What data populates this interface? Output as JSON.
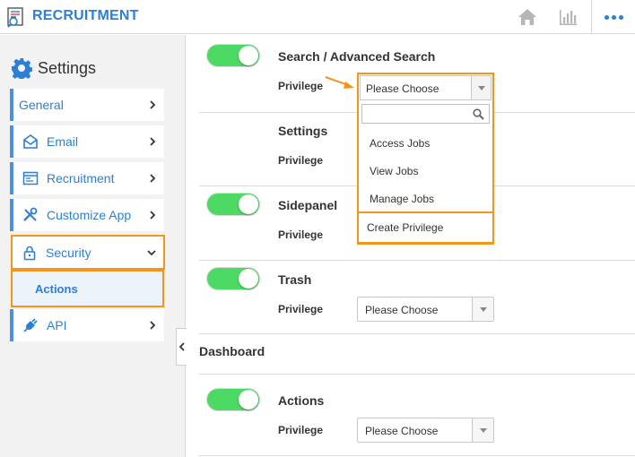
{
  "header": {
    "app_title": "RECRUITMENT",
    "icons": [
      "recruitment-logo-icon",
      "home-icon",
      "bar-chart-icon",
      "more-icon"
    ],
    "accent_color": "#2b7fd6"
  },
  "sidebar": {
    "heading": "Settings",
    "items": [
      {
        "label": "General",
        "icon": ""
      },
      {
        "label": "Email",
        "icon": "envelope-icon"
      },
      {
        "label": "Recruitment",
        "icon": "window-icon"
      },
      {
        "label": "Customize App",
        "icon": "tools-icon"
      },
      {
        "label": "Security",
        "icon": "lock-icon",
        "expanded": true
      },
      {
        "label": "API",
        "icon": "plug-icon"
      }
    ],
    "sub_item": "Actions",
    "highlight_color": "#f3951c"
  },
  "main": {
    "sections": [
      {
        "title": "Search / Advanced Search",
        "privilege_label": "Privilege",
        "toggle_on": true,
        "select_value": "Please Choose"
      },
      {
        "title": "Settings",
        "privilege_label": "Privilege",
        "toggle_on": false
      },
      {
        "title": "Sidepanel",
        "privilege_label": "Privilege",
        "toggle_on": true
      },
      {
        "title": "Trash",
        "privilege_label": "Privilege",
        "toggle_on": true,
        "select_value": "Please Choose"
      }
    ],
    "dashboard_heading": "Dashboard",
    "dashboard_sections": [
      {
        "title": "Actions",
        "privilege_label": "Privilege",
        "toggle_on": true,
        "select_value": "Please Choose"
      }
    ],
    "toggle_color": "#4cd964"
  },
  "dropdown": {
    "selected": "Please Choose",
    "search_placeholder": "",
    "options": [
      "Access Jobs",
      "View Jobs",
      "Manage Jobs"
    ],
    "create_label": "Create Privilege"
  }
}
